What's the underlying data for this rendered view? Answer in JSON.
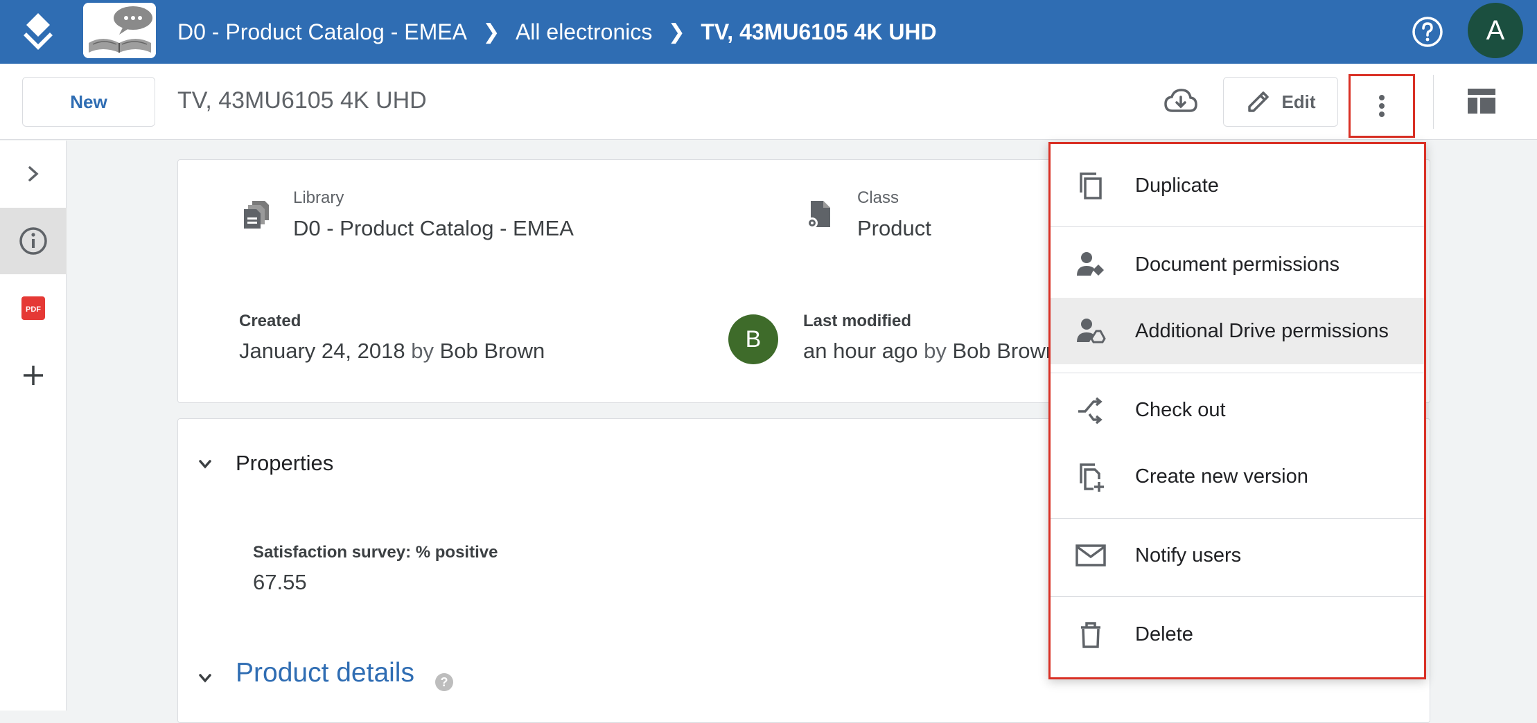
{
  "topbar": {
    "breadcrumbs": [
      "D0 - Product Catalog - EMEA",
      "All electronics",
      "TV, 43MU6105 4K UHD"
    ],
    "avatar_initial": "A"
  },
  "toolbar": {
    "new_label": "New",
    "doc_title": "TV, 43MU6105 4K UHD",
    "edit_label": "Edit"
  },
  "rail": {
    "pdf_label": "PDF"
  },
  "info": {
    "library_label": "Library",
    "library_value": "D0 - Product Catalog - EMEA",
    "class_label": "Class",
    "class_value": "Product",
    "created_label": "Created",
    "created_date": "January 24, 2018",
    "created_by_word": "by",
    "created_by": "Bob Brown",
    "modified_avatar": "B",
    "modified_label": "Last modified",
    "modified_when": "an hour ago",
    "modified_by_word": "by",
    "modified_by": "Bob Brown"
  },
  "properties": {
    "title": "Properties",
    "field_label": "Satisfaction survey: % positive",
    "field_value": "67.55",
    "product_details_title": "Product details",
    "help_glyph": "?"
  },
  "menu": {
    "items": [
      {
        "label": "Duplicate",
        "icon": "copy-icon"
      },
      {
        "label": "Document permissions",
        "icon": "user-permissions-icon"
      },
      {
        "label": "Additional Drive permissions",
        "icon": "drive-permissions-icon"
      },
      {
        "label": "Check out",
        "icon": "check-out-icon"
      },
      {
        "label": "Create new version",
        "icon": "new-version-icon"
      },
      {
        "label": "Notify users",
        "icon": "mail-icon"
      },
      {
        "label": "Delete",
        "icon": "trash-icon"
      }
    ]
  },
  "colors": {
    "topbar": "#2f6db3",
    "highlight_border": "#d93025",
    "avatar_a": "#1b4f3f",
    "avatar_b": "#3e6b2a",
    "link": "#2f6db3"
  }
}
